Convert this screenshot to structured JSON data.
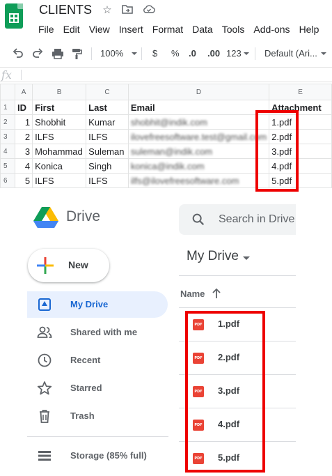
{
  "sheets": {
    "doc_title": "CLIENTS",
    "menu": [
      "File",
      "Edit",
      "View",
      "Insert",
      "Format",
      "Data",
      "Tools",
      "Add-ons",
      "Help"
    ],
    "toolbar": {
      "zoom": "100%",
      "currency": "$",
      "percent": "%",
      "dec_less": ".0",
      "dec_more": ".00",
      "format_more": "123",
      "font": "Default (Ari..."
    },
    "formula_prefix": "fx",
    "column_headers": [
      "A",
      "B",
      "C",
      "D",
      "E"
    ],
    "row_numbers": [
      "1",
      "2",
      "3",
      "4",
      "5",
      "6"
    ],
    "header_row": [
      "ID",
      "First",
      "Last",
      "Email",
      "Attachment"
    ],
    "rows": [
      [
        "1",
        "Shobhit",
        "Kumar",
        "shobhit@indik.com",
        "1.pdf"
      ],
      [
        "2",
        "ILFS",
        "ILFS",
        "ilovefreesoftware.test@gmail.com",
        "2.pdf"
      ],
      [
        "3",
        "Mohammad",
        "Suleman",
        "suleman@indik.com",
        "3.pdf"
      ],
      [
        "4",
        "Konica",
        "Singh",
        "konica@indik.com",
        "4.pdf"
      ],
      [
        "5",
        "ILFS",
        "ILFS",
        "ilfs@ilovefreesoftware.com",
        "5.pdf"
      ]
    ]
  },
  "drive": {
    "app_name": "Drive",
    "search_placeholder": "Search in Drive",
    "new_label": "New",
    "nav": [
      {
        "label": "My Drive",
        "icon": "my-drive-icon",
        "active": true
      },
      {
        "label": "Shared with me",
        "icon": "people-icon",
        "active": false
      },
      {
        "label": "Recent",
        "icon": "clock-icon",
        "active": false
      },
      {
        "label": "Starred",
        "icon": "star-icon",
        "active": false
      },
      {
        "label": "Trash",
        "icon": "trash-icon",
        "active": false
      }
    ],
    "storage_label": "Storage (85% full)",
    "main_title": "My Drive",
    "column_name": "Name",
    "files": [
      {
        "name": "1.pdf",
        "type_badge": "PDF"
      },
      {
        "name": "2.pdf",
        "type_badge": "PDF"
      },
      {
        "name": "3.pdf",
        "type_badge": "PDF"
      },
      {
        "name": "4.pdf",
        "type_badge": "PDF"
      },
      {
        "name": "5.pdf",
        "type_badge": "PDF"
      }
    ]
  },
  "colors": {
    "highlight": "#ee0000",
    "sheets_green": "#0f9d58",
    "drive_active_bg": "#e8f0fe",
    "drive_active_text": "#1967d2",
    "pdf_red": "#ea4335"
  }
}
